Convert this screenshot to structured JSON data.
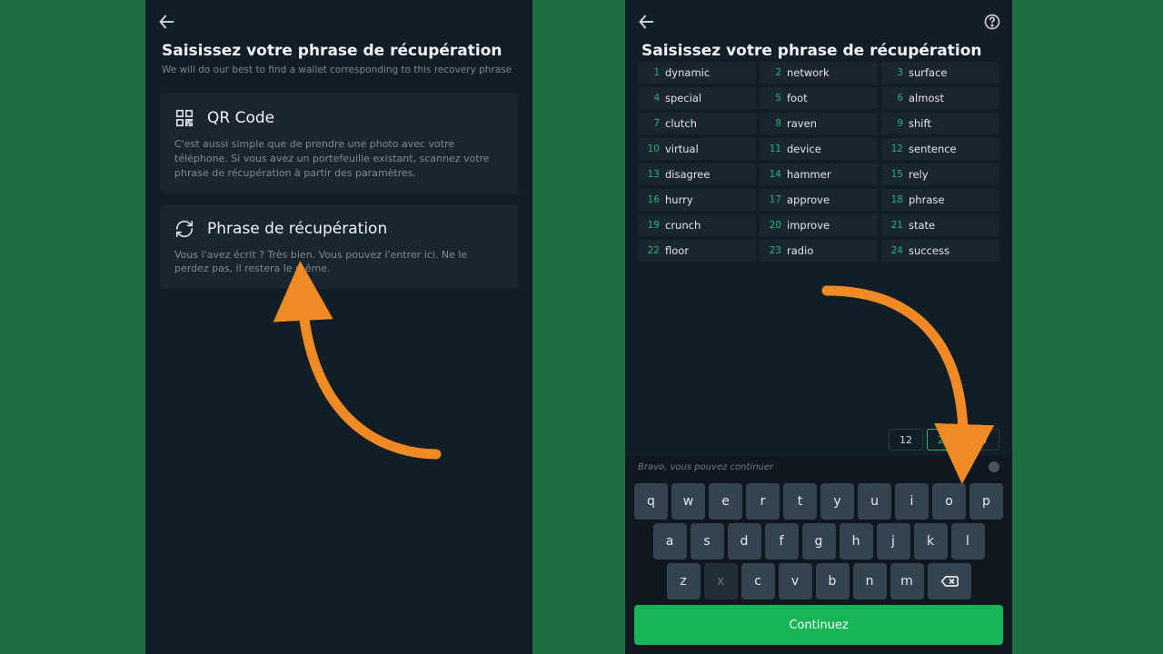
{
  "left": {
    "title": "Saisissez votre phrase de récupération",
    "subtitle": "We will do our best to find a wallet corresponding to this recovery phrase",
    "card_qr": {
      "title": "QR Code",
      "desc": "C'est aussi simple que de prendre une photo avec votre téléphone. Si vous avez un portefeuille existant, scannez votre phrase de récupération à partir des paramètres."
    },
    "card_phrase": {
      "title": "Phrase de récupération",
      "desc": "Vous l'avez écrit ? Très bien. Vous pouvez l'entrer ici. Ne le perdez pas, il restera le même."
    }
  },
  "right": {
    "title": "Saisissez votre phrase de récupération",
    "words": [
      {
        "i": 1,
        "w": "dynamic"
      },
      {
        "i": 2,
        "w": "network"
      },
      {
        "i": 3,
        "w": "surface"
      },
      {
        "i": 4,
        "w": "special"
      },
      {
        "i": 5,
        "w": "foot"
      },
      {
        "i": 6,
        "w": "almost"
      },
      {
        "i": 7,
        "w": "clutch"
      },
      {
        "i": 8,
        "w": "raven"
      },
      {
        "i": 9,
        "w": "shift"
      },
      {
        "i": 10,
        "w": "virtual"
      },
      {
        "i": 11,
        "w": "device"
      },
      {
        "i": 12,
        "w": "sentence"
      },
      {
        "i": 13,
        "w": "disagree"
      },
      {
        "i": 14,
        "w": "hammer"
      },
      {
        "i": 15,
        "w": "rely"
      },
      {
        "i": 16,
        "w": "hurry"
      },
      {
        "i": 17,
        "w": "approve"
      },
      {
        "i": 18,
        "w": "phrase"
      },
      {
        "i": 19,
        "w": "crunch"
      },
      {
        "i": 20,
        "w": "improve"
      },
      {
        "i": 21,
        "w": "state"
      },
      {
        "i": 22,
        "w": "floor"
      },
      {
        "i": 23,
        "w": "radio"
      },
      {
        "i": 24,
        "w": "success"
      }
    ],
    "counts": [
      {
        "v": "12",
        "active": false
      },
      {
        "v": "24",
        "active": true
      },
      {
        "v": "27",
        "active": false
      }
    ],
    "hint": "Bravo, vous pouvez continuer",
    "kbd_rows": [
      [
        "q",
        "w",
        "e",
        "r",
        "t",
        "y",
        "u",
        "i",
        "o",
        "p"
      ],
      [
        "a",
        "s",
        "d",
        "f",
        "g",
        "h",
        "j",
        "k",
        "l"
      ],
      [
        "z",
        "x",
        "c",
        "v",
        "b",
        "n",
        "m"
      ]
    ],
    "faded_keys": [
      "x"
    ],
    "continue_label": "Continuez"
  }
}
